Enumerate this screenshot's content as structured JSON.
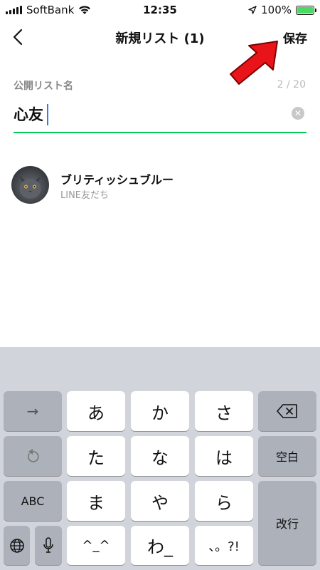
{
  "status_bar": {
    "carrier": "SoftBank",
    "time": "12:35",
    "battery": "100%"
  },
  "nav": {
    "title": "新規リスト (1)",
    "save_label": "保存"
  },
  "form": {
    "label": "公開リスト名",
    "counter": "2 / 20",
    "value": "心友"
  },
  "friend": {
    "name": "ブリティッシュブルー",
    "subtitle": "LINE友だち"
  },
  "keyboard": {
    "row1": [
      "→",
      "あ",
      "か",
      "さ"
    ],
    "row2": [
      "た",
      "な",
      "は",
      "空白"
    ],
    "row3": [
      "ABC",
      "ま",
      "や",
      "ら",
      "改行"
    ],
    "row4": [
      "^_^",
      "わ_",
      "、。?!"
    ]
  },
  "colors": {
    "accent": "#06c755",
    "arrow": "#e8141a",
    "caret": "#3478f6"
  }
}
